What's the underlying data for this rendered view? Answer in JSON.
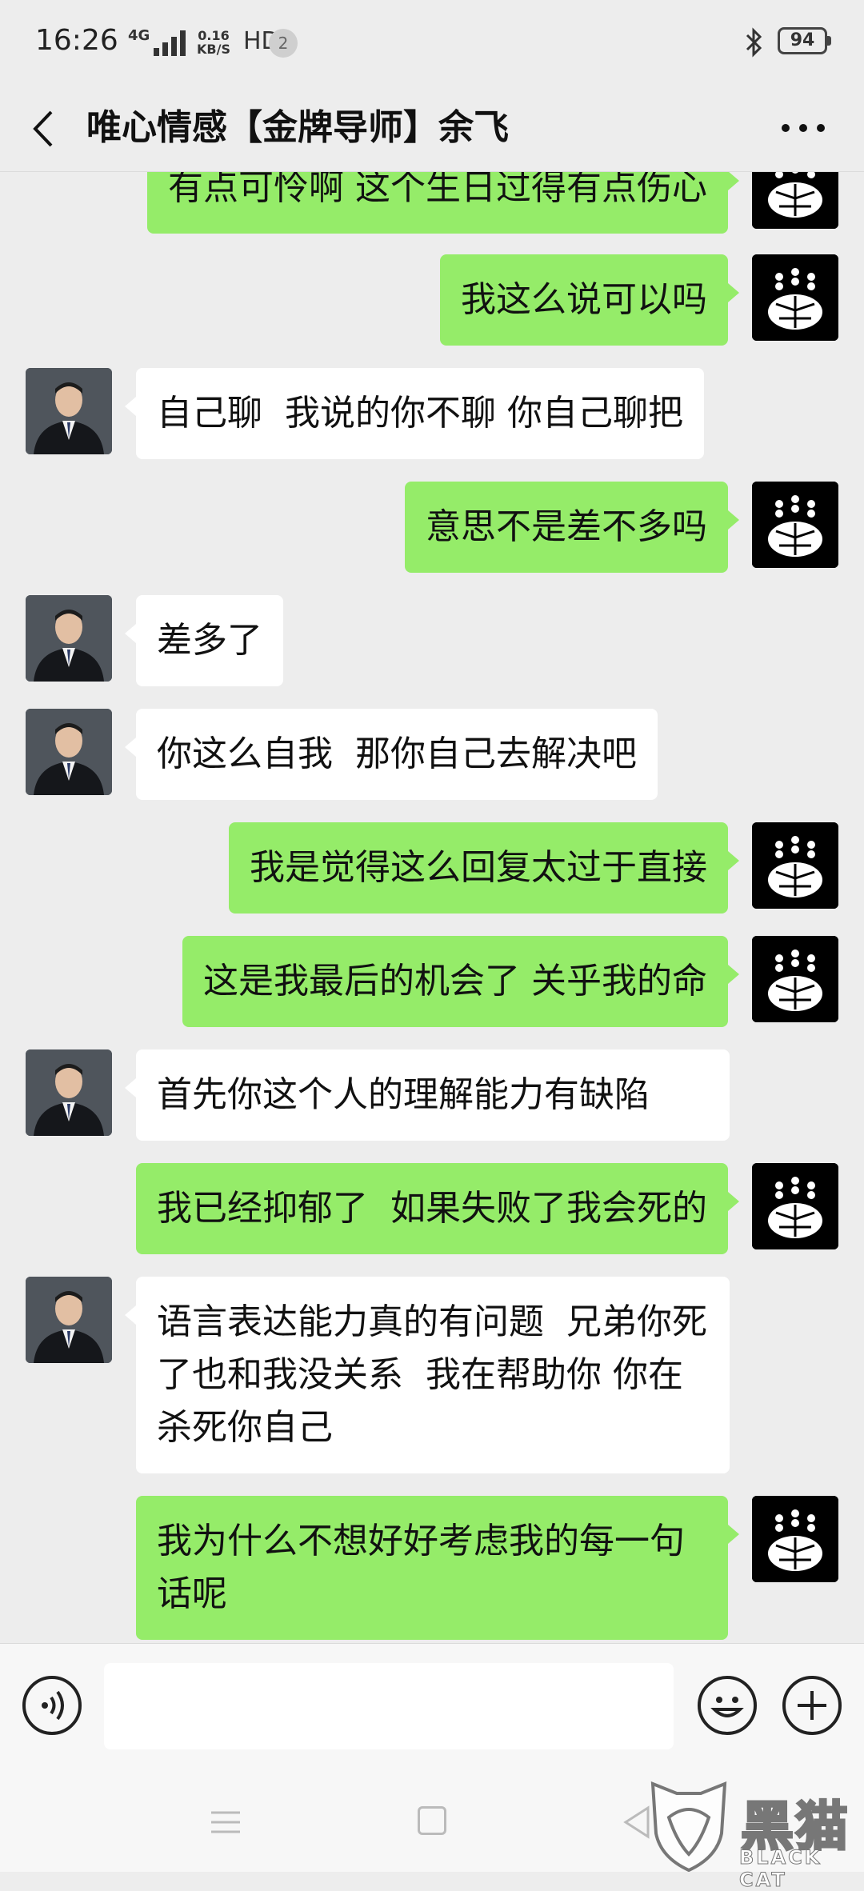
{
  "status_bar": {
    "time": "16:26",
    "network": "4G",
    "speed_value": "0.16",
    "speed_unit": "KB/S",
    "hd": "HD",
    "notification_count": "2",
    "battery": "94"
  },
  "header": {
    "back_icon": "chevron-left-icon",
    "title": "唯心情感【金牌导师】余飞",
    "more_icon": "more-dots-icon"
  },
  "messages": [
    {
      "side": "right",
      "text": "有点可怜啊 这个生日过得有点伤心"
    },
    {
      "side": "right",
      "text": "我这么说可以吗"
    },
    {
      "side": "left",
      "text": "自己聊  我说的你不聊 你自己聊把"
    },
    {
      "side": "right",
      "text": "意思不是差不多吗"
    },
    {
      "side": "left",
      "text": "差多了"
    },
    {
      "side": "left",
      "text": "你这么自我  那你自己去解决吧"
    },
    {
      "side": "right",
      "text": "我是觉得这么回复太过于直接"
    },
    {
      "side": "right",
      "text": "这是我最后的机会了 关乎我的命"
    },
    {
      "side": "left",
      "text": "首先你这个人的理解能力有缺陷"
    },
    {
      "side": "right",
      "text": "我已经抑郁了  如果失败了我会死的"
    },
    {
      "side": "left",
      "text": "语言表达能力真的有问题  兄弟你死了也和我没关系  我在帮助你 你在杀死你自己"
    },
    {
      "side": "right",
      "text": "我为什么不想好好考虑我的每一句话呢"
    }
  ],
  "input_bar": {
    "voice_icon": "voice-icon",
    "input_value": "",
    "emoji_icon": "emoji-icon",
    "plus_icon": "plus-icon"
  },
  "watermark": {
    "text": "黑猫",
    "sub": "BLACK CAT"
  }
}
